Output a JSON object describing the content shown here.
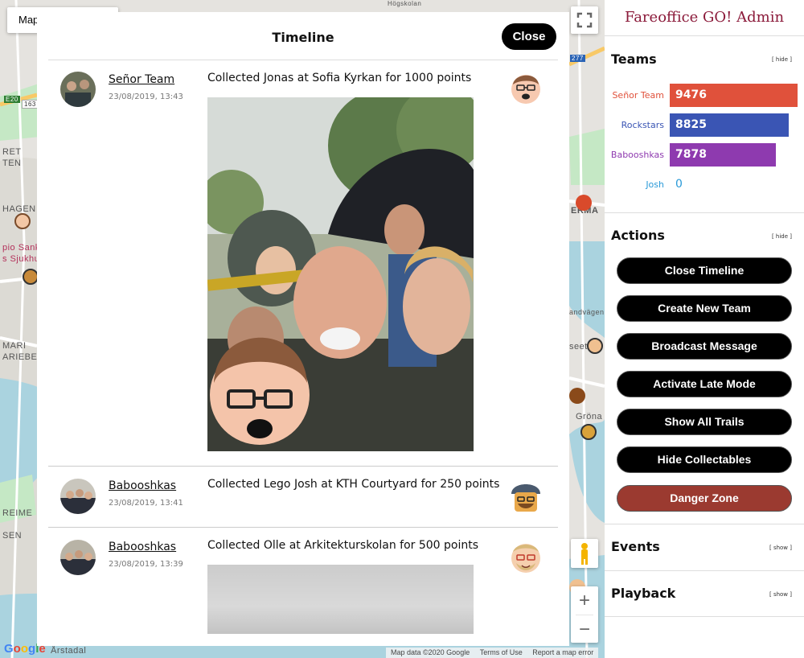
{
  "map": {
    "map_type_label": "Map",
    "labels": [
      "RET",
      "TEN",
      "HAGEN",
      "pio Sank",
      "s Sjukhus",
      "MARI",
      "ARIEBER",
      "REIME",
      "SEN",
      "Årstadal",
      "ERMA",
      "andvägen",
      "seet",
      "Gröna",
      "E20",
      "163",
      "277",
      "Högskolan"
    ],
    "google": "Google",
    "attribution": [
      "Map data ©2020 Google",
      "Terms of Use",
      "Report a map error"
    ],
    "zoom_in": "+",
    "zoom_out": "−",
    "colors": {
      "land": "#e5e3df",
      "water": "#aad3df",
      "park": "#c5e8c5",
      "road": "#ffffff",
      "highway": "#f8c967"
    }
  },
  "modal": {
    "title": "Timeline",
    "close_label": "Close",
    "entries": [
      {
        "team": "Señor Team",
        "time": "23/08/2019, 13:43",
        "text": "Collected Jonas at Sofia Kyrkan for 1000 points",
        "character": "jonas-avatar"
      },
      {
        "team": "Babooshkas",
        "time": "23/08/2019, 13:41",
        "text": "Collected Lego Josh at KTH Courtyard for 250 points",
        "character": "lego-josh-avatar"
      },
      {
        "team": "Babooshkas",
        "time": "23/08/2019, 13:39",
        "text": "Collected Olle at Arkitekturskolan for 500 points",
        "character": "olle-avatar"
      }
    ]
  },
  "sidebar": {
    "title": "Fareoffice GO! Admin",
    "teams": {
      "heading": "Teams",
      "toggle": "[ hide ]",
      "rows": [
        {
          "name": "Señor Team",
          "score": "9476",
          "value": 9476,
          "color": "#e0513b"
        },
        {
          "name": "Rockstars",
          "score": "8825",
          "value": 8825,
          "color": "#3a55b4"
        },
        {
          "name": "Babooshkas",
          "score": "7878",
          "value": 7878,
          "color": "#8e3aaf"
        },
        {
          "name": "Josh",
          "score": "0",
          "value": 0,
          "color": "#2a9ad8"
        }
      ]
    },
    "actions": {
      "heading": "Actions",
      "toggle": "[ hide ]",
      "buttons": [
        "Close Timeline",
        "Create New Team",
        "Broadcast Message",
        "Activate Late Mode",
        "Show All Trails",
        "Hide Collectables"
      ],
      "danger": "Danger Zone",
      "danger_color": "#9b3a30"
    },
    "events": {
      "heading": "Events",
      "toggle": "[ show ]"
    },
    "playback": {
      "heading": "Playback",
      "toggle": "[ show ]"
    }
  }
}
